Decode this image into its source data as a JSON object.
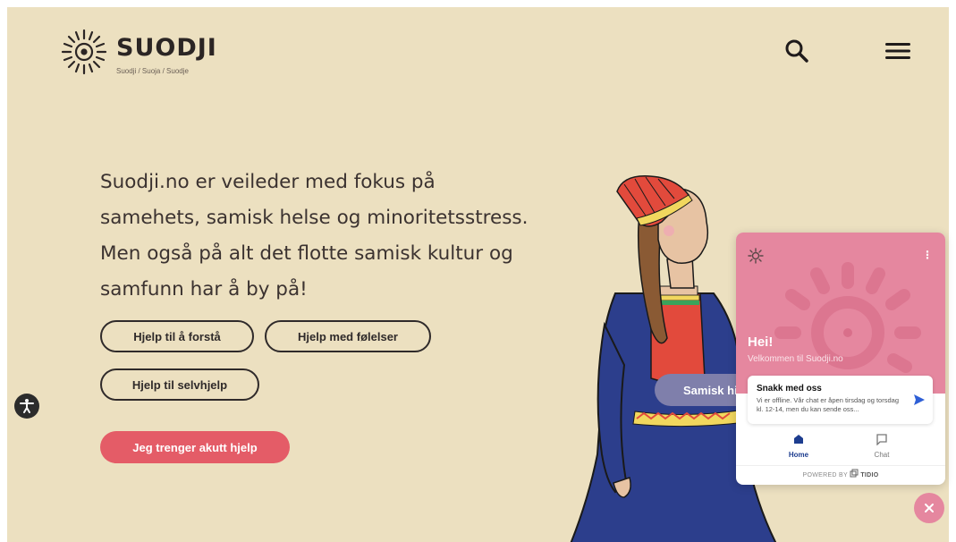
{
  "header": {
    "logo_word": "SUODJI",
    "logo_subtitle": "Suodji / Suoja / Suodje",
    "search_icon": "search-icon",
    "menu_icon": "hamburger-menu-icon"
  },
  "hero": {
    "lines": [
      "Suodji.no er veileder med fokus på",
      "samehets, samisk helse og minoritetsstress.",
      "Men også på alt det flotte samisk kultur og",
      "samfunn har å by på!"
    ]
  },
  "buttons": {
    "understand": "Hjelp til å forstå",
    "feelings": "Hjelp med følelser",
    "selfhelp": "Hjelp til selvhjelp",
    "urgent": "Jeg trenger akutt hjelp"
  },
  "side_tab": {
    "label": "Samisk historie"
  },
  "accessibility": {
    "icon": "accessibility-icon"
  },
  "chat": {
    "greeting": "Hei!",
    "welcome": "Velkommen til Suodji.no",
    "card_title": "Snakk med oss",
    "card_text": "Vi er offline. Vår chat er åpen tirsdag og torsdag kl. 12-14, men du kan sende oss...",
    "nav": [
      {
        "label": "Home",
        "icon": "home-icon"
      },
      {
        "label": "Chat",
        "icon": "chat-bubble-icon"
      }
    ],
    "powered_by": "POWERED BY",
    "brand": "TIDIO"
  },
  "colors": {
    "background": "#ece0c0",
    "accent_red": "#e45c67",
    "chat_pink": "#e5879f",
    "tab_purple": "#7f7fab",
    "nav_active": "#1d3d8f"
  }
}
